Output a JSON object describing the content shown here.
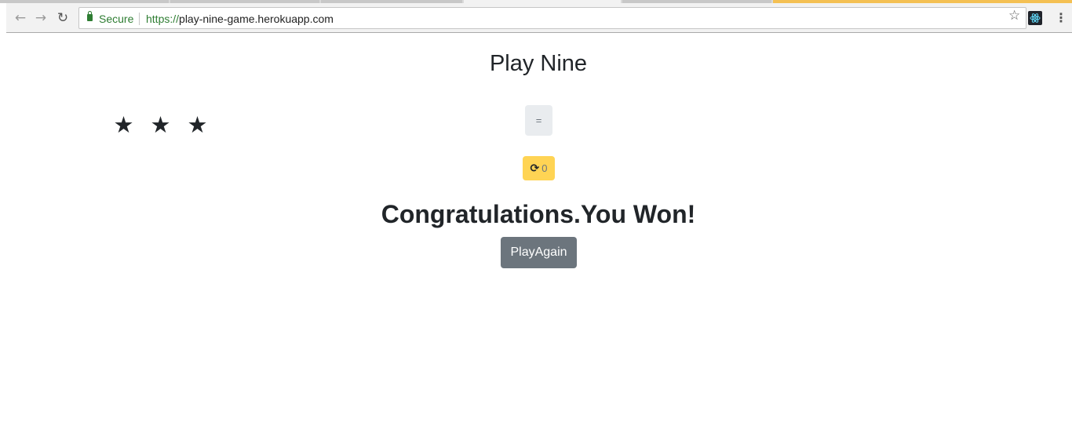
{
  "browser": {
    "secure_label": "Secure",
    "url_scheme": "https://",
    "url_rest": "play-nine-game.herokuapp.com",
    "icons": {
      "back": "arrow-left-icon",
      "forward": "arrow-right-icon",
      "reload": "reload-icon",
      "bookmark": "star-outline-icon",
      "extension": "react-devtools-icon",
      "menu": "kebab-menu-icon"
    }
  },
  "game": {
    "title": "Play Nine",
    "stars_count": 3,
    "equals_label": "=",
    "redraws_left": "0",
    "message": "Congratulations.You Won!",
    "play_again_label": "PlayAgain"
  },
  "colors": {
    "secure_green": "#2e7d32",
    "redraw_yellow": "#ffd454",
    "play_again_gray": "#6c757d",
    "equals_bg": "#e9ecef"
  }
}
